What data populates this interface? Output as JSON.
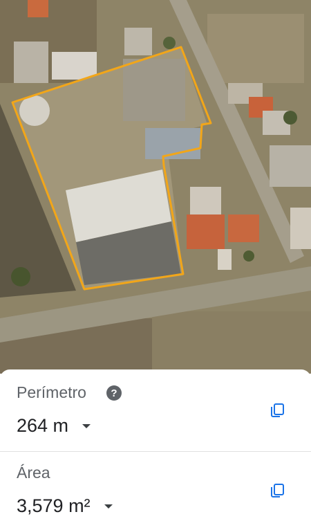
{
  "perimeter": {
    "label": "Perímetro",
    "value": "264 m",
    "help_icon": "help-icon",
    "copy_icon": "copy-icon"
  },
  "area": {
    "label": "Área",
    "value": "3,579 m²",
    "copy_icon": "copy-icon"
  },
  "colors": {
    "polygon_outline": "#f2a619",
    "icon_blue": "#1a73e8",
    "label_gray": "#5f6368",
    "value_dark": "#202124"
  }
}
